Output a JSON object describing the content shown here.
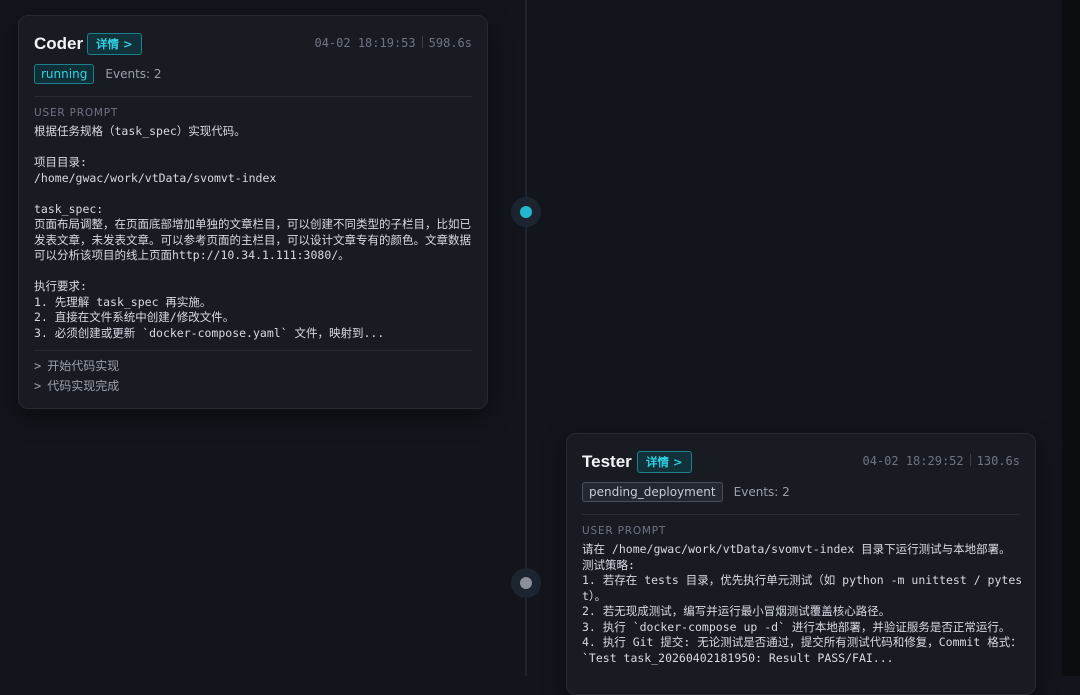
{
  "cards": [
    {
      "agent": "Coder",
      "detail_label": "详情 >",
      "timestamp": "04-02 18:19:53",
      "duration": "598.6s",
      "status": "running",
      "events": "Events: 2",
      "prompt_label": "USER PROMPT",
      "prompt": "根据任务规格（task_spec）实现代码。\n\n项目目录:\n/home/gwac/work/vtData/svomvt-index\n\ntask_spec:\n页面布局调整，在页面底部增加单独的文章栏目，可以创建不同类型的子栏目，比如已发表文章，未发表文章。可以参考页面的主栏目，可以设计文章专有的颜色。文章数据可以分析该项目的线上页面http://10.34.1.111:3080/。\n\n执行要求:\n1. 先理解 task_spec 再实施。\n2. 直接在文件系统中创建/修改文件。\n3. 必须创建或更新 `docker-compose.yaml` 文件，映射到...",
      "steps": [
        "开始代码实现",
        "代码实现完成"
      ]
    },
    {
      "agent": "Tester",
      "detail_label": "详情 >",
      "timestamp": "04-02 18:29:52",
      "duration": "130.6s",
      "status": "pending_deployment",
      "events": "Events: 2",
      "prompt_label": "USER PROMPT",
      "prompt": "请在 /home/gwac/work/vtData/svomvt-index 目录下运行测试与本地部署。\n测试策略:\n1. 若存在 tests 目录，优先执行单元测试（如 python -m unittest / pytest）。\n2. 若无现成测试，编写并运行最小冒烟测试覆盖核心路径。\n3. 执行 `docker-compose up -d` 进行本地部署，并验证服务是否正常运行。\n4. 执行 Git 提交: 无论测试是否通过，提交所有测试代码和修复，Commit 格式：`Test task_20260402181950: Result PASS/FAI..."
    }
  ],
  "timeline_nodes": [
    {
      "state": "active",
      "color": "#1fb8cc"
    },
    {
      "state": "idle",
      "color": "#8a8f98"
    }
  ],
  "colors": {
    "background": "#12151c",
    "card": "#181b22",
    "accent": "#2fd0e3"
  }
}
